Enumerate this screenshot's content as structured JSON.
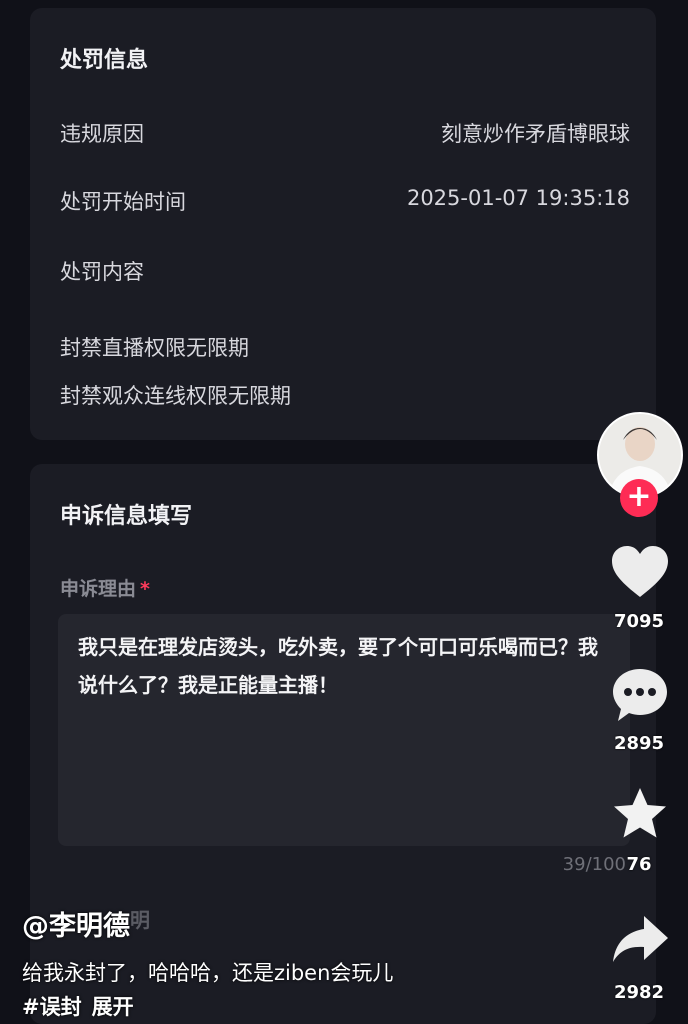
{
  "penalty_card": {
    "title": "处罚信息",
    "reason_label": "违规原因",
    "reason_value": "刻意炒作矛盾博眼球",
    "start_label": "处罚开始时间",
    "start_value": "2025-01-07 19:35:18",
    "content_label": "处罚内容",
    "content_lines": [
      "封禁直播权限无限期",
      "封禁观众连线权限无限期"
    ]
  },
  "appeal_card": {
    "title": "申诉信息填写",
    "reason_label": "申诉理由",
    "required_mark": "*",
    "reason_text": "我只是在理发店烫头，吃外卖，要了个可口可乐喝而已？我说什么了？我是正能量主播！",
    "counter": "39/100",
    "ghost_label": "明"
  },
  "rail": {
    "follow": "+",
    "likes": "7095",
    "comments": "2895",
    "favorites": "76",
    "shares": "2982"
  },
  "overlay": {
    "author": "@李明德",
    "caption": "给我永封了，哈哈哈，还是ziben会玩儿",
    "hashtag": "#误封",
    "expand": "展开"
  },
  "colors": {
    "background": "#101118",
    "card": "#1b1c24",
    "accent_red": "#fe2c55"
  }
}
